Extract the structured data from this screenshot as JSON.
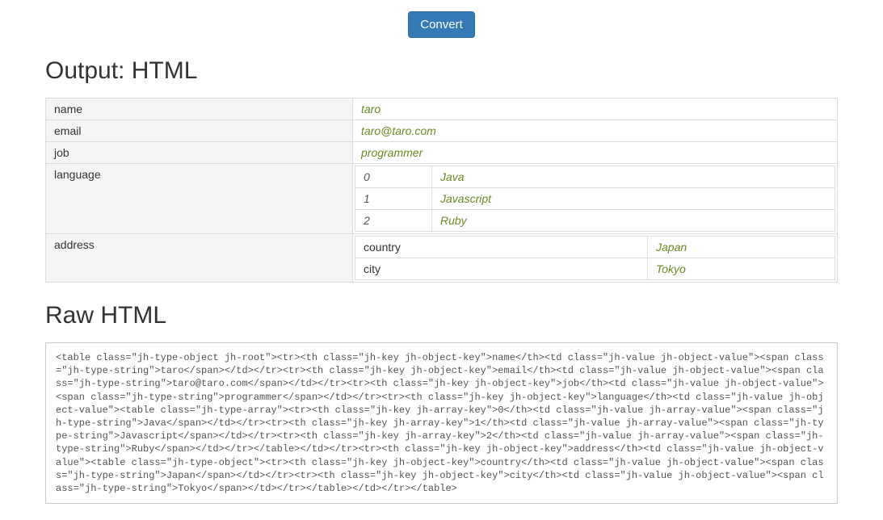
{
  "buttons": {
    "convert": "Convert"
  },
  "headings": {
    "output": "Output: HTML",
    "raw": "Raw HTML"
  },
  "table": {
    "rows": {
      "name": {
        "key": "name",
        "value": "taro"
      },
      "email": {
        "key": "email",
        "value": "taro@taro.com"
      },
      "job": {
        "key": "job",
        "value": "programmer"
      },
      "language": {
        "key": "language",
        "items": [
          {
            "index": "0",
            "value": "Java"
          },
          {
            "index": "1",
            "value": "Javascript"
          },
          {
            "index": "2",
            "value": "Ruby"
          }
        ]
      },
      "address": {
        "key": "address",
        "fields": {
          "country": {
            "key": "country",
            "value": "Japan"
          },
          "city": {
            "key": "city",
            "value": "Tokyo"
          }
        }
      }
    }
  },
  "raw_html": "<table class=\"jh-type-object jh-root\"><tr><th class=\"jh-key jh-object-key\">name</th><td class=\"jh-value jh-object-value\"><span class=\"jh-type-string\">taro</span></td></tr><tr><th class=\"jh-key jh-object-key\">email</th><td class=\"jh-value jh-object-value\"><span class=\"jh-type-string\">taro@taro.com</span></td></tr><tr><th class=\"jh-key jh-object-key\">job</th><td class=\"jh-value jh-object-value\"><span class=\"jh-type-string\">programmer</span></td></tr><tr><th class=\"jh-key jh-object-key\">language</th><td class=\"jh-value jh-object-value\"><table class=\"jh-type-array\"><tr><th class=\"jh-key jh-array-key\">0</th><td class=\"jh-value jh-array-value\"><span class=\"jh-type-string\">Java</span></td></tr><tr><th class=\"jh-key jh-array-key\">1</th><td class=\"jh-value jh-array-value\"><span class=\"jh-type-string\">Javascript</span></td></tr><tr><th class=\"jh-key jh-array-key\">2</th><td class=\"jh-value jh-array-value\"><span class=\"jh-type-string\">Ruby</span></td></tr></table></td></tr><tr><th class=\"jh-key jh-object-key\">address</th><td class=\"jh-value jh-object-value\"><table class=\"jh-type-object\"><tr><th class=\"jh-key jh-object-key\">country</th><td class=\"jh-value jh-object-value\"><span class=\"jh-type-string\">Japan</span></td></tr><tr><th class=\"jh-key jh-object-key\">city</th><td class=\"jh-value jh-object-value\"><span class=\"jh-type-string\">Tokyo</span></td></tr></table></td></tr></table>"
}
